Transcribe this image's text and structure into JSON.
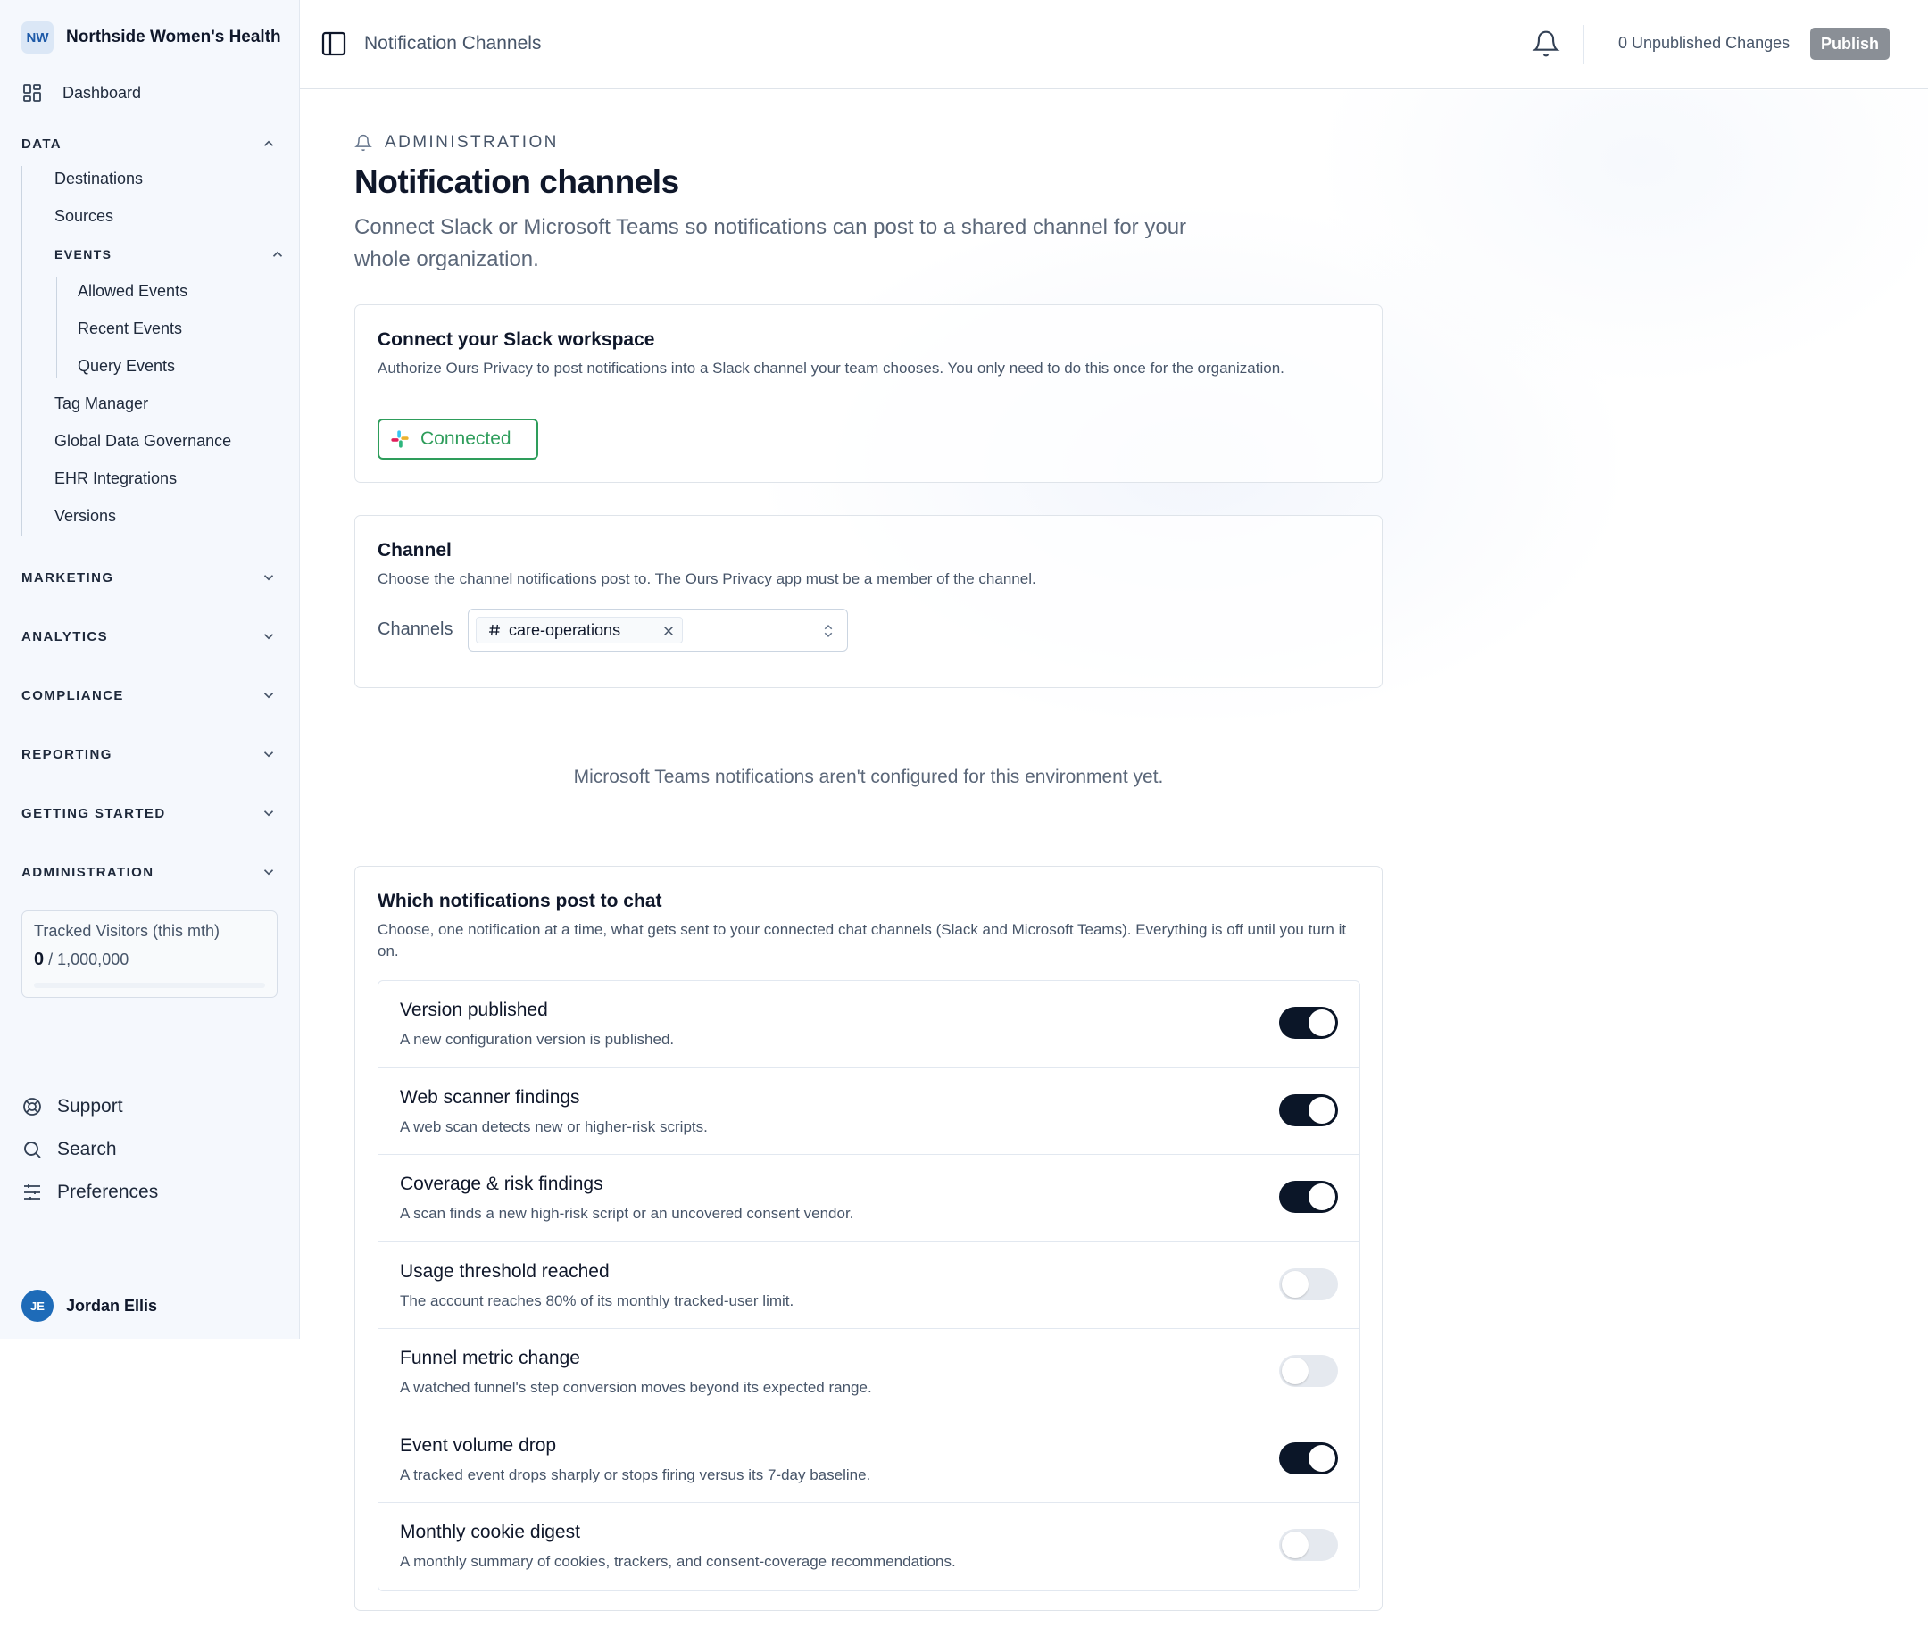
{
  "sidebar": {
    "org_initials": "NW",
    "org_name": "Northside Women's Health",
    "dashboard": "Dashboard",
    "data_section": "DATA",
    "data_items": [
      "Destinations",
      "Sources"
    ],
    "events_section": "EVENTS",
    "events_items": [
      "Allowed Events",
      "Recent Events",
      "Query Events"
    ],
    "data_items_after": [
      "Tag Manager",
      "Global Data Governance",
      "EHR Integrations",
      "Versions"
    ],
    "sections": [
      "MARKETING",
      "ANALYTICS",
      "COMPLIANCE",
      "REPORTING",
      "GETTING STARTED",
      "ADMINISTRATION"
    ],
    "visitors": {
      "label": "Tracked Visitors (this mth)",
      "count": "0",
      "limit": "/ 1,000,000",
      "used_fraction": 0
    },
    "footer": {
      "support": "Support",
      "search": "Search",
      "preferences": "Preferences"
    },
    "user": {
      "initials": "JE",
      "name": "Jordan Ellis"
    }
  },
  "topbar": {
    "title": "Notification Channels",
    "unpublished": "0 Unpublished Changes",
    "publish": "Publish"
  },
  "page": {
    "breadcrumb": "ADMINISTRATION",
    "title": "Notification channels",
    "description": "Connect Slack or Microsoft Teams so notifications can post to a shared channel for your whole organization."
  },
  "slack": {
    "title": "Connect your Slack workspace",
    "description": "Authorize Ours Privacy to post notifications into a Slack channel your team chooses. You only need to do this once for the organization.",
    "status": "Connected"
  },
  "channel": {
    "title": "Channel",
    "description": "Choose the channel notifications post to. The Ours Privacy app must be a member of the channel.",
    "label": "Channels",
    "selected": "care-operations"
  },
  "teams_note": "Microsoft Teams notifications aren't configured for this environment yet.",
  "notifications": {
    "title": "Which notifications post to chat",
    "description": "Choose, one notification at a time, what gets sent to your connected chat channels (Slack and Microsoft Teams). Everything is off until you turn it on.",
    "items": [
      {
        "title": "Version published",
        "desc": "A new configuration version is published.",
        "on": true
      },
      {
        "title": "Web scanner findings",
        "desc": "A web scan detects new or higher-risk scripts.",
        "on": true
      },
      {
        "title": "Coverage & risk findings",
        "desc": "A scan finds a new high-risk script or an uncovered consent vendor.",
        "on": true
      },
      {
        "title": "Usage threshold reached",
        "desc": "The account reaches 80% of its monthly tracked-user limit.",
        "on": false
      },
      {
        "title": "Funnel metric change",
        "desc": "A watched funnel's step conversion moves beyond its expected range.",
        "on": false
      },
      {
        "title": "Event volume drop",
        "desc": "A tracked event drops sharply or stops firing versus its 7-day baseline.",
        "on": true
      },
      {
        "title": "Monthly cookie digest",
        "desc": "A monthly summary of cookies, trackers, and consent-coverage recommendations.",
        "on": false
      }
    ]
  },
  "colors": {
    "accent_dark": "#0b1628",
    "connected_green": "#2e9d5b",
    "sidebar_bg": "#f5f8fd",
    "publish_bg": "#8a8f96"
  }
}
